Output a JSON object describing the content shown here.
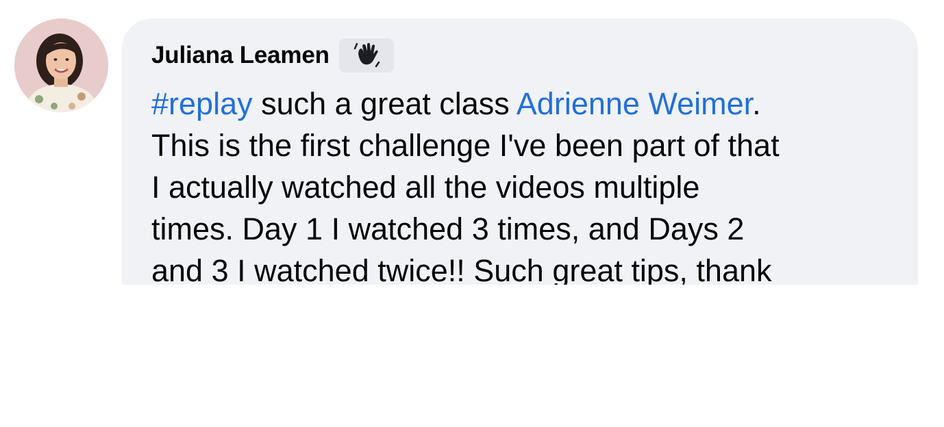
{
  "comment": {
    "author": "Juliana Leamen",
    "badge_icon": "waving-hand-icon",
    "hashtag": "#replay",
    "text_after_hashtag": " such a great class ",
    "mention": "Adrienne Weimer",
    "text_after_mention": ".",
    "lines": [
      "This is the first challenge I've been part of that",
      "I actually watched all the videos multiple",
      "times. Day 1 I watched 3 times, and Days 2",
      "and 3 I watched twice!! Such great tips, thank"
    ]
  },
  "colors": {
    "bubble_background": "#f0f2f5",
    "link": "#216fdb",
    "text": "#050505",
    "badge_background": "#e4e6eb"
  }
}
